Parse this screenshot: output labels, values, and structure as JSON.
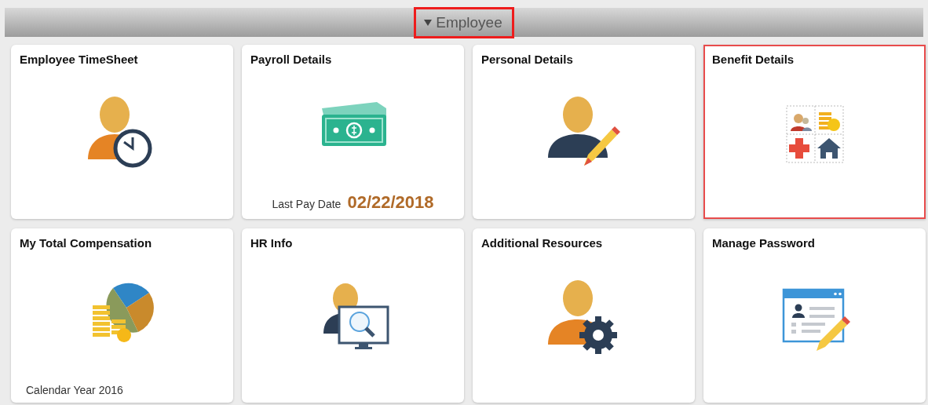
{
  "header": {
    "menu": {
      "label": "Employee",
      "highlighted": true
    }
  },
  "tiles": [
    {
      "title": "Employee TimeSheet",
      "kind": "person-clock",
      "highlighted": false
    },
    {
      "title": "Payroll Details",
      "kind": "money",
      "highlighted": false,
      "footer": {
        "label": "Last Pay Date",
        "value": "02/22/2018"
      }
    },
    {
      "title": "Personal Details",
      "kind": "person-pencil",
      "highlighted": false
    },
    {
      "title": "Benefit Details",
      "kind": "benefits",
      "highlighted": true
    },
    {
      "title": "My Total Compensation",
      "kind": "pie-coins",
      "highlighted": false,
      "footer": {
        "label": "Calendar Year 2016"
      }
    },
    {
      "title": "HR Info",
      "kind": "person-monitor",
      "highlighted": false
    },
    {
      "title": "Additional Resources",
      "kind": "person-gear",
      "highlighted": false
    },
    {
      "title": "Manage Password",
      "kind": "profile-form",
      "highlighted": false
    }
  ]
}
